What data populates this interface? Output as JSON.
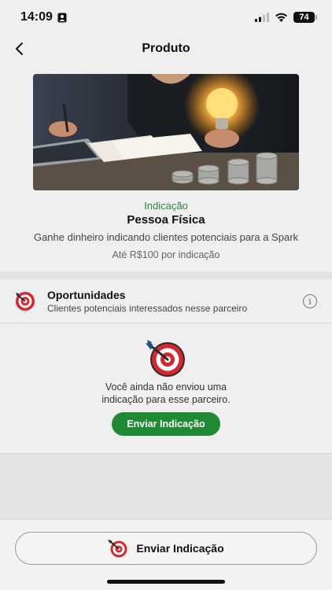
{
  "status_bar": {
    "time": "14:09",
    "battery": "74"
  },
  "nav": {
    "title": "Produto",
    "back_icon": "chevron-left-icon"
  },
  "product": {
    "category": "Indicação",
    "name": "Pessoa Física",
    "description": "Ganhe dinheiro indicando clientes potenciais para a Spark",
    "reward": "Até R$100 por indicação"
  },
  "opportunities": {
    "title": "Oportunidades",
    "subtitle": "Clientes potenciais interessados nesse parceiro",
    "icon": "target-icon",
    "info_icon": "info-icon"
  },
  "empty_state": {
    "line1": "Você ainda não enviou uma",
    "line2": "indicação para esse parceiro.",
    "button_label": "Enviar Indicação"
  },
  "bottom": {
    "button_label": "Enviar Indicação"
  },
  "colors": {
    "accent_green": "#1f8a33",
    "category_green": "#2a8a3b",
    "target_red": "#d8262f"
  }
}
